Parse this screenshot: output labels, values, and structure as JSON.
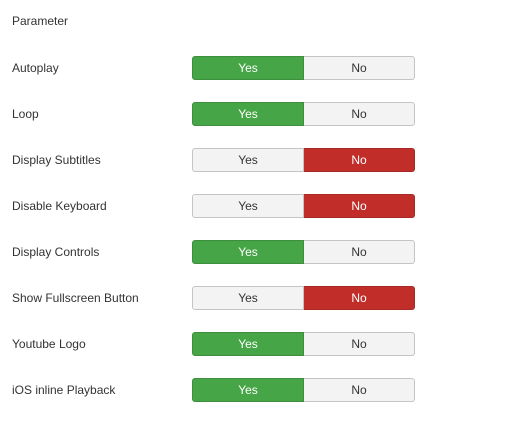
{
  "section": {
    "title": "Parameter"
  },
  "colors": {
    "yes_active": "#46a546",
    "no_active": "#c12e2a",
    "inactive": "#f3f3f3"
  },
  "rows": [
    {
      "label": "Autoplay",
      "yes": "Yes",
      "no": "No",
      "selected": "yes"
    },
    {
      "label": "Loop",
      "yes": "Yes",
      "no": "No",
      "selected": "yes"
    },
    {
      "label": "Display Subtitles",
      "yes": "Yes",
      "no": "No",
      "selected": "no"
    },
    {
      "label": "Disable Keyboard",
      "yes": "Yes",
      "no": "No",
      "selected": "no"
    },
    {
      "label": "Display Controls",
      "yes": "Yes",
      "no": "No",
      "selected": "yes"
    },
    {
      "label": "Show Fullscreen Button",
      "yes": "Yes",
      "no": "No",
      "selected": "no"
    },
    {
      "label": "Youtube Logo",
      "yes": "Yes",
      "no": "No",
      "selected": "yes"
    },
    {
      "label": "iOS inline Playback",
      "yes": "Yes",
      "no": "No",
      "selected": "yes"
    }
  ]
}
